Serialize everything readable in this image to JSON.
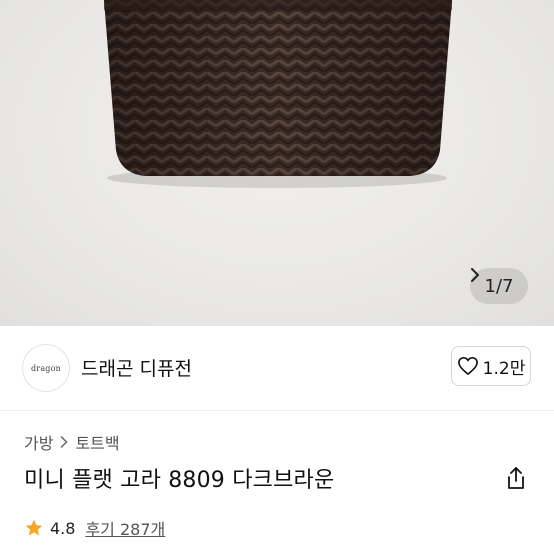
{
  "gallery": {
    "counter": "1/7",
    "icons": {
      "next": "chevron-right-icon"
    },
    "colors": {
      "background": "#e9e8e6",
      "product": "#3a2a24"
    }
  },
  "brand": {
    "logo_text": "dragon",
    "name": "드래곤 디퓨전",
    "like_count": "1.2만",
    "icons": {
      "like": "heart-outline-icon"
    }
  },
  "breadcrumb": {
    "items": [
      "가방",
      "토트백"
    ],
    "icons": {
      "separator": "chevron-right-icon"
    }
  },
  "product": {
    "title": "미니 플랫 고라 8809 다크브라운",
    "icons": {
      "share": "share-icon"
    }
  },
  "rating": {
    "score": "4.8",
    "reviews_label": "후기 287개",
    "icons": {
      "star": "star-filled-icon"
    },
    "colors": {
      "star": "#f5a623"
    }
  }
}
